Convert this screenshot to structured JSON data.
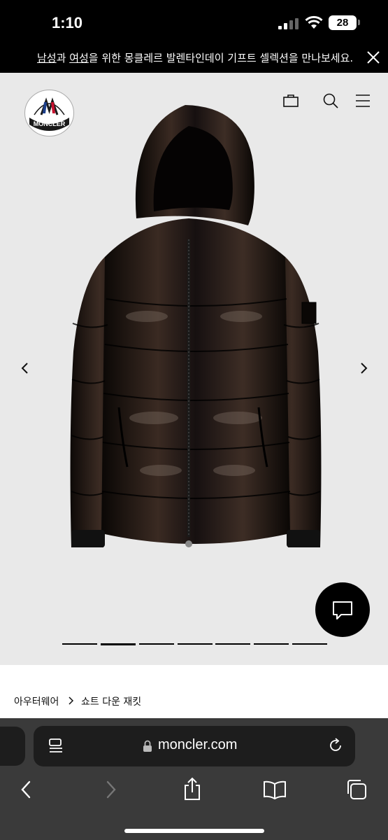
{
  "status_bar": {
    "time": "1:10",
    "battery": "28"
  },
  "promo": {
    "link1": "남성",
    "mid1": "과 ",
    "link2": "여성",
    "rest": "을 위한 몽클레르 발렌타인데이 기프트 셀렉션을 만나보세요."
  },
  "header": {
    "logo_text": "MONCLER",
    "icons": [
      "shopping-bag-icon",
      "search-icon",
      "menu-icon"
    ]
  },
  "gallery": {
    "slide_count": 7,
    "active_index": 1,
    "product_image": "black-glossy-down-jacket"
  },
  "breadcrumb": {
    "items": [
      "아우터웨어",
      "쇼트 다운 재킷"
    ]
  },
  "browser": {
    "url": "moncler.com",
    "toolbar": [
      "back-icon",
      "forward-icon",
      "share-icon",
      "bookmarks-icon",
      "tabs-icon"
    ]
  },
  "colors": {
    "hero_bg": "#e9e9e9",
    "browser_bg": "#3a3a3a",
    "url_bg": "#1d1d1d"
  }
}
